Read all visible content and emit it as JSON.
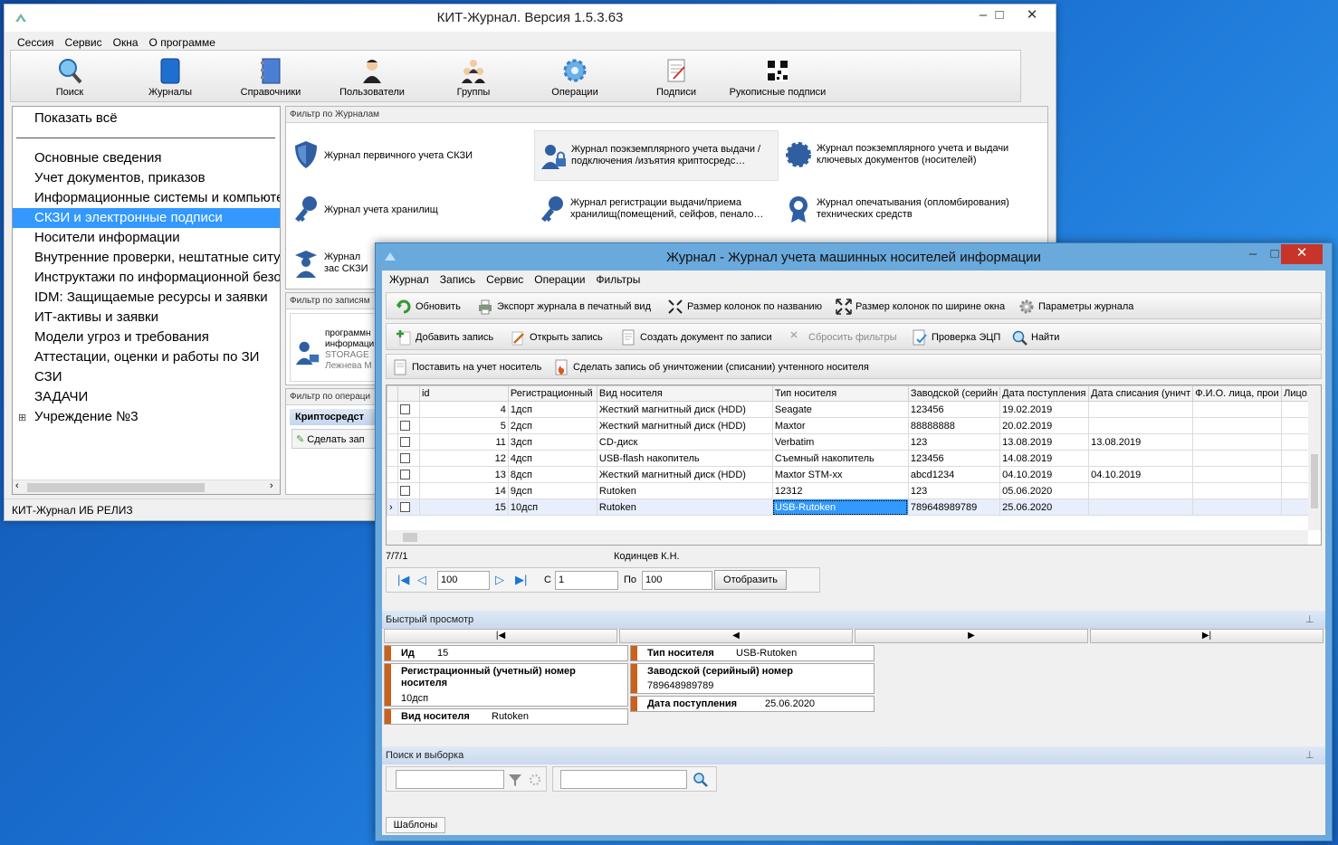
{
  "main_window": {
    "title": "КИТ-Журнал. Версия 1.5.3.63",
    "menu": [
      "Сессия",
      "Сервис",
      "Окна",
      "О программе"
    ],
    "toolbar": [
      "Поиск",
      "Журналы",
      "Справочники",
      "Пользователи",
      "Группы",
      "Операции",
      "Подписи",
      "Рукописные подписи"
    ],
    "tree_show_all": "Показать всё",
    "tree_items": [
      "Основные сведения",
      "Учет документов, приказов",
      "Информационные системы и компьютеры",
      "СКЗИ и электронные подписи",
      "Носители информации",
      "Внутренние проверки, нештатные ситуации",
      "Инструктажи по информационной безопасности",
      "IDM: Защищаемые ресурсы  и заявки",
      "ИТ-активы и заявки",
      "Модели угроз и требования",
      "Аттестации, оценки и работы по ЗИ",
      "СЗИ",
      "ЗАДАЧИ",
      "Учреждение №3"
    ],
    "tree_expand": "⊞",
    "filter_journals_title": "Фильтр по Журналам",
    "journals": [
      "Журнал первичного учета СКЗИ",
      "Журнал поэкземплярного учета выдачи /подключения /изъятия криптосредс…",
      "Журнал поэкземплярного учета и выдачи ключевых документов (носителей)",
      "Журнал учета хранилищ",
      "Журнал регистрации выдачи/приема хранилищ(помещений, сейфов, пенало…",
      "Журнал опечатывания (опломбирования) технических средств",
      "Журнал зас СКЗИ"
    ],
    "filter_records_title": "Фильтр по записям",
    "record_snippet": [
      "программн",
      "информаци",
      "STORAGE",
      "Лежнева М"
    ],
    "filter_ops_title": "Фильтр по операци",
    "ops_header": "Криптосредст",
    "ops_button": "Сделать зап",
    "status": "КИТ-Журнал ИБ РЕЛИЗ"
  },
  "journal_window": {
    "title": "Журнал - Журнал учета машинных носителей информации",
    "menu": [
      "Журнал",
      "Запись",
      "Сервис",
      "Операции",
      "Фильтры"
    ],
    "toolbar_row1": [
      "Обновить",
      "Экспорт журнала в печатный вид",
      "Размер колонок по названию",
      "Размер колонок по ширине окна",
      "Параметры журнала"
    ],
    "toolbar_row2": [
      "Добавить запись",
      "Открыть запись",
      "Создать документ по записи",
      "Сбросить фильтры",
      "Проверка ЭЦП",
      "Найти"
    ],
    "toolbar_row3": [
      "Поставить на учет носитель",
      "Сделать запись об уничтожении (списании) учтенного носителя"
    ],
    "columns": [
      "id",
      "Регистрационный",
      "Вид носителя",
      "Тип носителя",
      "Заводской (серийн",
      "Дата поступления",
      "Дата списания (уничт",
      "Ф.И.О. лица, прои",
      "Лицо, п"
    ],
    "rows": [
      [
        "4",
        "1дсп",
        "Жесткий магнитный диск (HDD)",
        "Seagate",
        "123456",
        "19.02.2019",
        "",
        "",
        ""
      ],
      [
        "5",
        "2дсп",
        "Жесткий магнитный диск (HDD)",
        "Maxtor",
        "88888888",
        "20.02.2019",
        "",
        "",
        ""
      ],
      [
        "11",
        "3дсп",
        "CD-диск",
        "Verbatim",
        "123",
        "13.08.2019",
        "13.08.2019",
        "",
        ""
      ],
      [
        "12",
        "4дсп",
        "USB-flash накопитель",
        "Съемный накопитель",
        "123456",
        "14.08.2019",
        "",
        "",
        ""
      ],
      [
        "13",
        "8дсп",
        "Жесткий магнитный диск (HDD)",
        "Maxtor STM-xx",
        "abcd1234",
        "04.10.2019",
        "04.10.2019",
        "",
        ""
      ],
      [
        "14",
        "9дсп",
        "Rutoken",
        "12312",
        "123",
        "05.06.2020",
        "",
        "",
        ""
      ],
      [
        "15",
        "10дсп",
        "Rutoken",
        "USB-Rutoken",
        "789648989789",
        "25.06.2020",
        "",
        "",
        ""
      ]
    ],
    "counter": "7/7/1",
    "user": "Кодинцев К.Н.",
    "page_size": "100",
    "from_label": "С",
    "from_value": "1",
    "to_label": "По",
    "to_value": "100",
    "show_button": "Отобразить",
    "quick_view_title": "Быстрый просмотр",
    "quick_nav": [
      "|◀",
      "◀",
      "▶",
      "▶|"
    ],
    "qv": {
      "id_label": "Ид",
      "id_value": "15",
      "reg_label": "Регистрационный (учетный) номер носителя",
      "reg_value": "10дсп",
      "kind_label": "Вид носителя",
      "kind_value": "Rutoken",
      "type_label": "Тип носителя",
      "type_value": "USB-Rutoken",
      "serial_label": "Заводской (серийный) номер",
      "serial_value": "789648989789",
      "date_label": "Дата поступления",
      "date_value": "25.06.2020"
    },
    "search_title": "Поиск и выборка",
    "templates_tab": "Шаблоны"
  },
  "colors": {
    "selection": "#3399ff",
    "accent": "#c8621c",
    "window_frame": "#6aa9dc"
  }
}
